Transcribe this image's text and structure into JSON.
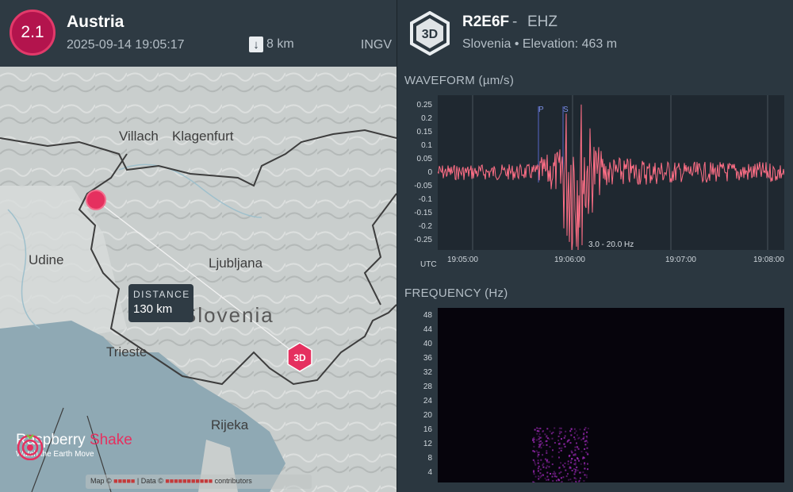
{
  "event": {
    "magnitude": "2.1",
    "region": "Austria",
    "datetime": "2025-09-14 19:05:17",
    "depth": "8 km",
    "source": "INGV"
  },
  "map": {
    "cities": [
      "Villach",
      "Klagenfurt",
      "Udine",
      "Ljubljana",
      "Trieste",
      "Rijeka"
    ],
    "country": "Slovenia",
    "distance_label": "DISTANCE",
    "distance_value": "130 km",
    "station_marker": "3D",
    "epicenter_color": "#e5305f",
    "attribution": {
      "prefix": "Map ©",
      "data": "| Data ©",
      "contributors": "contributors"
    }
  },
  "brand": {
    "name_a": "Raspberry",
    "name_b": "Shake",
    "tagline": "Watch the Earth Move",
    "accent": "#e5305f"
  },
  "station": {
    "badge": "3D",
    "code": "R2E6F",
    "separator": "-",
    "channel": "EHZ",
    "info": "Slovenia • Elevation: 463 m"
  },
  "waveform": {
    "title": "WAVEFORM  (µm/s)",
    "filter": "3.0 - 20.0 Hz",
    "utc_label": "UTC",
    "y_ticks": [
      "0.25",
      "0.2",
      "0.15",
      "0.1",
      "0.05",
      "0",
      "-0.05",
      "-0.1",
      "-0.15",
      "-0.2",
      "-0.25"
    ],
    "x_ticks": [
      "19:05:00",
      "19:06:00",
      "19:07:00",
      "19:08:00"
    ],
    "phase_p": "P",
    "phase_s": "S",
    "trace_color": "#ff6f86"
  },
  "frequency": {
    "title": "FREQUENCY  (Hz)",
    "y_ticks": [
      "48",
      "44",
      "40",
      "36",
      "32",
      "28",
      "24",
      "20",
      "16",
      "12",
      "8",
      "4"
    ],
    "energy_color": "#a12bbb"
  }
}
